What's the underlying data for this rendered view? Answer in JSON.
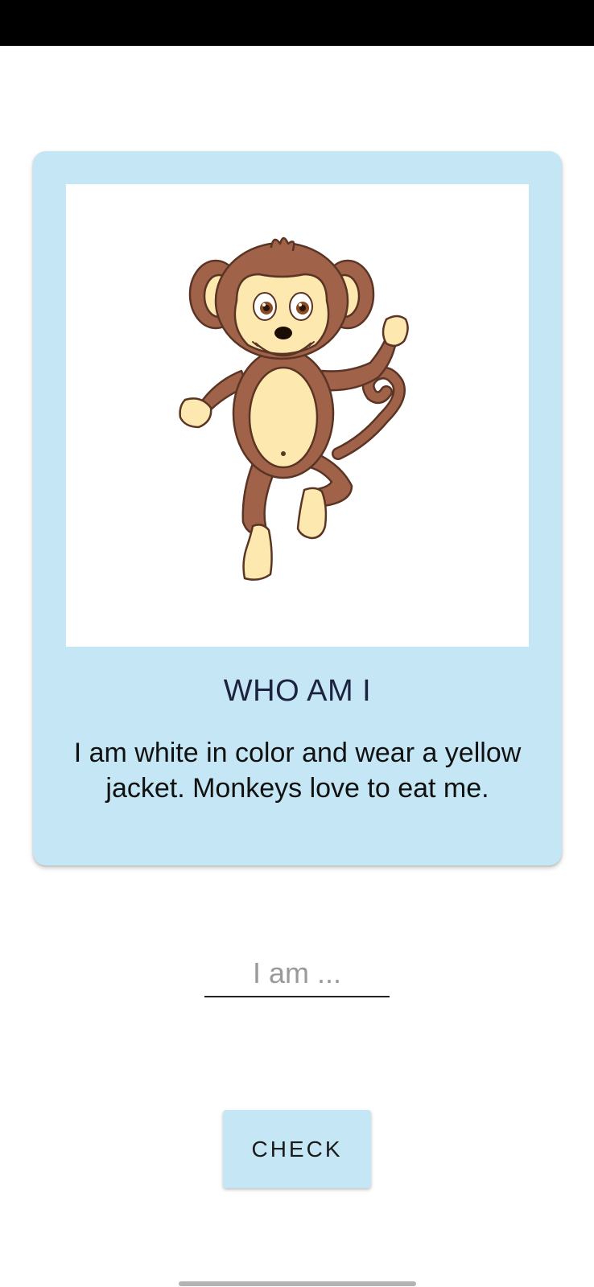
{
  "card": {
    "image": "monkey-illustration",
    "title": "WHO AM I",
    "clue": "I am white in color and wear a yellow jacket. Monkeys love to eat me."
  },
  "answer": {
    "value": "",
    "placeholder": "I am ..."
  },
  "actions": {
    "check_label": "CHECK"
  },
  "colors": {
    "card_background": "#c5e6f4",
    "status_bar": "#000000",
    "monkey_fur": "#a0634a",
    "monkey_skin": "#fde8b0"
  }
}
